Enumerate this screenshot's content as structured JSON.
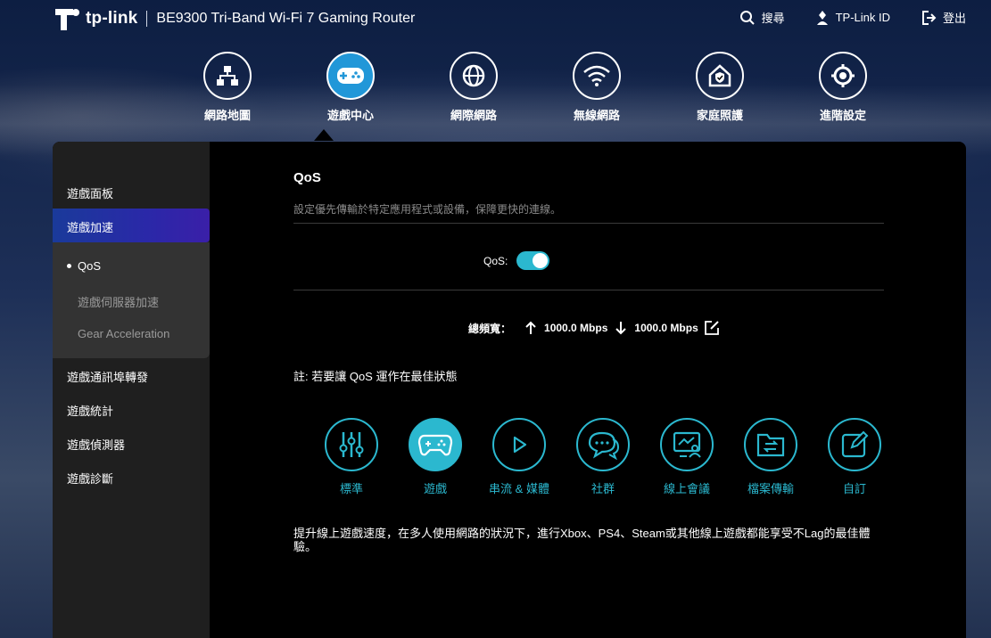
{
  "header": {
    "brand": "tp-link",
    "product": "BE9300 Tri-Band Wi-Fi 7 Gaming Router",
    "links": [
      {
        "icon": "search-icon",
        "label": "搜尋"
      },
      {
        "icon": "user-icon",
        "label": "TP-Link ID"
      },
      {
        "icon": "logout-icon",
        "label": "登出"
      }
    ]
  },
  "main_nav": [
    {
      "icon": "network-map-icon",
      "label": "網路地圖"
    },
    {
      "icon": "gamepad-icon",
      "label": "遊戲中心",
      "active": true
    },
    {
      "icon": "globe-icon",
      "label": "網際網路"
    },
    {
      "icon": "wifi-icon",
      "label": "無線網路"
    },
    {
      "icon": "home-shield-icon",
      "label": "家庭照護"
    },
    {
      "icon": "gear-icon",
      "label": "進階設定"
    }
  ],
  "sidebar": {
    "items": [
      "遊戲面板",
      "遊戲加速",
      "遊戲通訊埠轉發",
      "遊戲統計",
      "遊戲偵測器",
      "遊戲診斷"
    ],
    "sub_items": [
      "QoS",
      "遊戲伺服器加速",
      "Gear Acceleration"
    ]
  },
  "content": {
    "title": "QoS",
    "description": "設定優先傳輸於特定應用程式或設備，保障更快的連線。",
    "qos_label": "QoS:",
    "qos_enabled": true,
    "bandwidth_label": "總頻寬：",
    "upload": "1000.0 Mbps",
    "download": "1000.0 Mbps",
    "note": "註: 若要讓 QoS 運作在最佳狀態",
    "modes": [
      {
        "icon": "sliders-icon",
        "label": "標準"
      },
      {
        "icon": "gamepad-icon",
        "label": "遊戲",
        "active": true
      },
      {
        "icon": "play-icon",
        "label": "串流 & 媒體"
      },
      {
        "icon": "chat-icon",
        "label": "社群"
      },
      {
        "icon": "meeting-icon",
        "label": "線上會議"
      },
      {
        "icon": "file-transfer-icon",
        "label": "檔案傳輸"
      },
      {
        "icon": "edit-icon",
        "label": "自訂"
      }
    ],
    "mode_description": "提升線上遊戲速度，在多人使用網路的狀況下，進行Xbox、PS4、Steam或其他線上遊戲都能享受不Lag的最佳體驗。"
  },
  "colors": {
    "accent": "#2bb8cf",
    "nav_active": "#2197d8"
  }
}
